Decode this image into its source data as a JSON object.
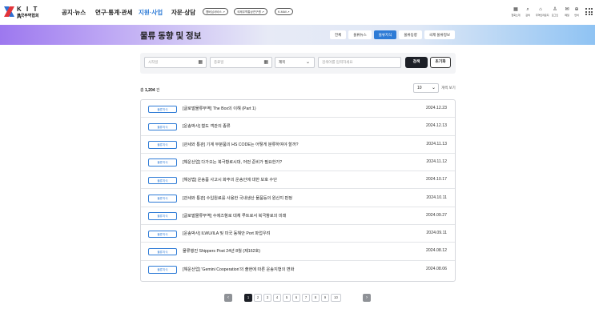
{
  "header": {
    "logo_text": "K I T A",
    "logo_subtext": "한국무역협회",
    "nav": [
      {
        "label": "공지·뉴스",
        "active": false
      },
      {
        "label": "연구·통계·관세",
        "active": false
      },
      {
        "label": "지원·사업",
        "active": true
      },
      {
        "label": "자문·상담",
        "active": false
      }
    ],
    "quick_links": [
      {
        "label": "멤버십서비스 ↗"
      },
      {
        "label": "국제무역통상연구원 ↗"
      },
      {
        "label": "K-MAll ↗"
      }
    ],
    "utilities": [
      {
        "icon": "building-icon",
        "glyph": "▦",
        "label": "협회소개"
      },
      {
        "icon": "search-icon",
        "glyph": "⌕",
        "label": "검색"
      },
      {
        "icon": "lounge-icon",
        "glyph": "⌂",
        "label": "무역인라운지"
      },
      {
        "icon": "user-icon",
        "glyph": "♙",
        "label": "로그인"
      },
      {
        "icon": "mail-icon",
        "glyph": "✉",
        "label": "메일"
      },
      {
        "icon": "globe-icon",
        "glyph": "⊕",
        "label": "언어"
      }
    ]
  },
  "banner": {
    "title": "물류 동향 및 정보",
    "tabs": [
      {
        "label": "전체",
        "active": false
      },
      {
        "label": "물류뉴스",
        "active": false
      },
      {
        "label": "물류지식",
        "active": true
      },
      {
        "label": "물류동향",
        "active": false
      },
      {
        "label": "국제 물류정보",
        "active": false
      }
    ]
  },
  "search": {
    "start_date_placeholder": "시작일",
    "end_date_placeholder": "종료일",
    "field_select": "제목",
    "keyword_placeholder": "검색어를 입력하세요",
    "search_label": "검색",
    "reset_label": "초기화"
  },
  "list_meta": {
    "total_prefix": "총",
    "total_count": "1,204",
    "total_suffix": "건",
    "page_size": "10",
    "page_size_label": "개씩 보기"
  },
  "rows": [
    {
      "category": "물류지식",
      "title": "[글로벌물류무역] The Box의 이해 (Part 1)",
      "date": "2024.12.23"
    },
    {
      "category": "물류지식",
      "title": "[운송박사] 철도 객관의 종류",
      "date": "2024.12.13"
    },
    {
      "category": "물류지식",
      "title": "[관세와 통관] 기계 부분품의 HS CODE는 어떻게 분류하여야 할까?",
      "date": "2024.11.13"
    },
    {
      "category": "물류지식",
      "title": "[해운산업] 다가오는 북극항로시대, 어떤 준비가 필요한가?",
      "date": "2024.11.12"
    },
    {
      "category": "물류지식",
      "title": "[해상법] 운송품 사고시 화주의 운송인에 대한 보호 수단",
      "date": "2024.10.17"
    },
    {
      "category": "물류지식",
      "title": "[관세와 통관] 수입원료를 사용한 국내생산 물품등의 원산지 판정",
      "date": "2024.10.11"
    },
    {
      "category": "물류지식",
      "title": "[글로벌물류무역] 수에즈항로 대체 루트로서 북극항로의 미래",
      "date": "2024.09.27"
    },
    {
      "category": "물류지식",
      "title": "[운송박사] ILWU/ILA 및 미국 동해안 Port 파업우려",
      "date": "2024.09.11"
    },
    {
      "category": "물류지식",
      "title": "물류행진 Shippers Post 24년 8월 (제162호)",
      "date": "2024.08.12"
    },
    {
      "category": "물류지식",
      "title": "[해운산업] 'Gemini Cooperation'의 출현에 따른 운송지형의 변화",
      "date": "2024.08.06"
    }
  ],
  "pagination": {
    "prev": "‹",
    "next": "›",
    "pages": [
      "1",
      "2",
      "3",
      "4",
      "5",
      "6",
      "7",
      "8",
      "9",
      "10"
    ],
    "current": "1"
  },
  "colors": {
    "accent": "#2e7bd6",
    "dark_button": "#1c1f26"
  }
}
